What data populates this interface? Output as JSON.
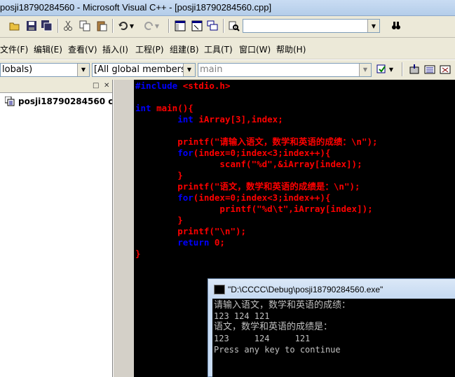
{
  "window": {
    "title": "posji18790284560 - Microsoft Visual C++ - [posji18790284560.cpp]"
  },
  "toolbar": {
    "icons": [
      "open-folder-icon",
      "save-icon",
      "save-all-icon",
      "cut-icon",
      "copy-icon",
      "paste-icon",
      "undo-icon",
      "redo-icon",
      "workspace-icon",
      "output-icon",
      "window-list-icon",
      "find-in-files-icon",
      "find-icon"
    ],
    "find_value": ""
  },
  "menubar": {
    "items": [
      "文件(F)",
      "编辑(E)",
      "查看(V)",
      "插入(I)",
      "工程(P)",
      "组建(B)",
      "工具(T)",
      "窗口(W)",
      "帮助(H)"
    ]
  },
  "wizardbar": {
    "class_combo": "lobals)",
    "filter_combo": "[All global members",
    "member_combo": "main"
  },
  "workspace": {
    "tree_item": "posji18790284560 c"
  },
  "editor": {
    "lines": [
      [
        [
          "kw",
          "#include "
        ],
        [
          "tx",
          "<stdio.h>"
        ]
      ],
      [],
      [
        [
          "kw",
          "int "
        ],
        [
          "tx",
          "main(){"
        ]
      ],
      [
        [
          "tx",
          "        "
        ],
        [
          "kw",
          "int "
        ],
        [
          "tx",
          "iArray[3],index;"
        ]
      ],
      [],
      [
        [
          "tx",
          "        printf(\"请输入语文，数学和英语的成绩：\\n\");"
        ]
      ],
      [
        [
          "tx",
          "        "
        ],
        [
          "kw",
          "for"
        ],
        [
          "tx",
          "(index=0;index<3;index++){"
        ]
      ],
      [
        [
          "tx",
          "                scanf(\"%d\",&iArray[index]);"
        ]
      ],
      [
        [
          "tx",
          "        }"
        ]
      ],
      [
        [
          "tx",
          "        printf(\"语文，数学和英语的成绩是：\\n\");"
        ]
      ],
      [
        [
          "tx",
          "        "
        ],
        [
          "kw",
          "for"
        ],
        [
          "tx",
          "(index=0;index<3;index++){"
        ]
      ],
      [
        [
          "tx",
          "                printf(\"%d\\t\",iArray[index]);"
        ]
      ],
      [
        [
          "tx",
          "        }"
        ]
      ],
      [
        [
          "tx",
          "        printf(\"\\n\");"
        ]
      ],
      [
        [
          "tx",
          "        "
        ],
        [
          "kw",
          "return "
        ],
        [
          "tx",
          "0;"
        ]
      ],
      [
        [
          "tx",
          "}"
        ]
      ]
    ]
  },
  "console": {
    "title": "\"D:\\CCCC\\Debug\\posji18790284560.exe\"",
    "lines": [
      "请输入语文，数学和英语的成绩：",
      "123 124 121",
      "语文，数学和英语的成绩是：",
      "123     124     121",
      "Press any key to continue"
    ]
  },
  "colors": {
    "keyword": "#0000ff",
    "text": "#ff0000",
    "editor_bg": "#000000"
  }
}
